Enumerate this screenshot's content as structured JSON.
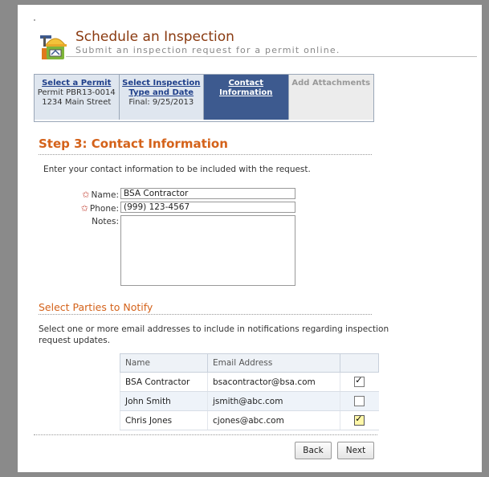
{
  "header": {
    "title": "Schedule an Inspection",
    "subtitle": "Submit an inspection request for a permit online.",
    "icon": "inspection-helmet-icon"
  },
  "steps": [
    {
      "label": "Select a Permit",
      "sub1": "Permit PBR13-0014",
      "sub2": "1234 Main Street",
      "state": "done"
    },
    {
      "label1": "Select Inspection",
      "label2": "Type and Date",
      "sub1": "Final: 9/25/2013",
      "state": "done"
    },
    {
      "label": "Contact Information",
      "state": "active"
    },
    {
      "label": "Add Attachments",
      "state": "disabled"
    }
  ],
  "step_heading": "Step 3: Contact Information",
  "intro": "Enter your contact information to be included with the request.",
  "form": {
    "name_label": "Name:",
    "name_value": "BSA Contractor",
    "phone_label": "Phone:",
    "phone_value": "(999) 123-4567",
    "notes_label": "Notes:",
    "notes_value": ""
  },
  "notify": {
    "heading": "Select Parties to Notify",
    "description": "Select one or more email addresses to include in notifications regarding inspection request updates.",
    "columns": [
      "Name",
      "Email Address",
      ""
    ],
    "rows": [
      {
        "name": "BSA Contractor",
        "email": "bsacontractor@bsa.com",
        "checked": true
      },
      {
        "name": "John Smith",
        "email": "jsmith@abc.com",
        "checked": false
      },
      {
        "name": "Chris Jones",
        "email": "cjones@abc.com",
        "checked": true
      }
    ]
  },
  "buttons": {
    "back": "Back",
    "next": "Next"
  },
  "colors": {
    "accent": "#d4621a",
    "active_step": "#3d5a8f",
    "title": "#8a3a10"
  }
}
